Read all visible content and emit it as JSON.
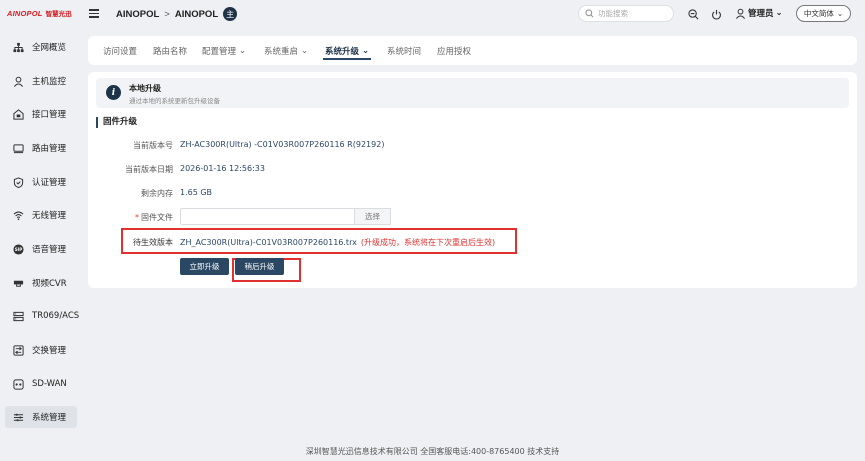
{
  "header": {
    "logo_brand": "AINOPOL",
    "logo_sub": "智慧光迅",
    "breadcrumb": [
      "AINOPOL",
      "AINOPOL"
    ],
    "breadcrumb_sep": ">",
    "badge": "主",
    "search_placeholder": "功能搜索",
    "user": "管理员",
    "user_caret": "⌄",
    "language": "中文简体",
    "language_caret": "⌄"
  },
  "sidebar": {
    "items": [
      {
        "label": "全网概览",
        "icon": "network-icon"
      },
      {
        "label": "主机监控",
        "icon": "user-icon"
      },
      {
        "label": "接口管理",
        "icon": "interface-icon"
      },
      {
        "label": "路由管理",
        "icon": "router-icon"
      },
      {
        "label": "认证管理",
        "icon": "shield-icon"
      },
      {
        "label": "无线管理",
        "icon": "wifi-icon"
      },
      {
        "label": "语音管理",
        "icon": "sip-icon"
      },
      {
        "label": "视频CVR",
        "icon": "camera-icon"
      },
      {
        "label": "TR069/ACS",
        "icon": "server-icon"
      },
      {
        "label": "交换管理",
        "icon": "switch-icon"
      },
      {
        "label": "SD-WAN",
        "icon": "sdwan-icon"
      },
      {
        "label": "系统管理",
        "icon": "sliders-icon",
        "active": true
      }
    ]
  },
  "tabs": [
    {
      "label": "访问设置",
      "caret": ""
    },
    {
      "label": "路由名称",
      "caret": ""
    },
    {
      "label": "配置管理",
      "caret": "⌄"
    },
    {
      "label": "系统重启",
      "caret": "⌄"
    },
    {
      "label": "系统升级",
      "caret": "⌄",
      "active": true
    },
    {
      "label": "系统时间",
      "caret": ""
    },
    {
      "label": "应用授权",
      "caret": ""
    }
  ],
  "main": {
    "info_icon": "i",
    "info_title": "本地升级",
    "info_desc": "通过本地的系统更新包升级设备",
    "section_title": "固件升级",
    "current_version_label": "当前版本号",
    "current_version": "ZH-AC300R(Ultra) -C01V03R007P260116 R(92192)",
    "current_date_label": "当前版本日期",
    "current_date": "2026-01-16 12:56:33",
    "free_memory_label": "剩余内存",
    "free_memory": "1.65 GB",
    "file_required": "*",
    "file_label": "固件文件",
    "file_value": "",
    "select_button": "选择",
    "pending_label": "待生效版本",
    "pending_version": "ZH_AC300R(Ultra)-C01V03R007P260116.trx",
    "pending_note": "(升级成功，系统将在下次重启后生效)",
    "upgrade_now": "立即升级",
    "upgrade_later": "稍后升级"
  },
  "footer": "深圳智慧光迅信息技术有限公司 全国客服电话:400-8765400 技术支持",
  "colors": {
    "primary": "#2a4864",
    "highlight": "#e03030",
    "brand": "#d71920",
    "background": "#eef0f3"
  }
}
